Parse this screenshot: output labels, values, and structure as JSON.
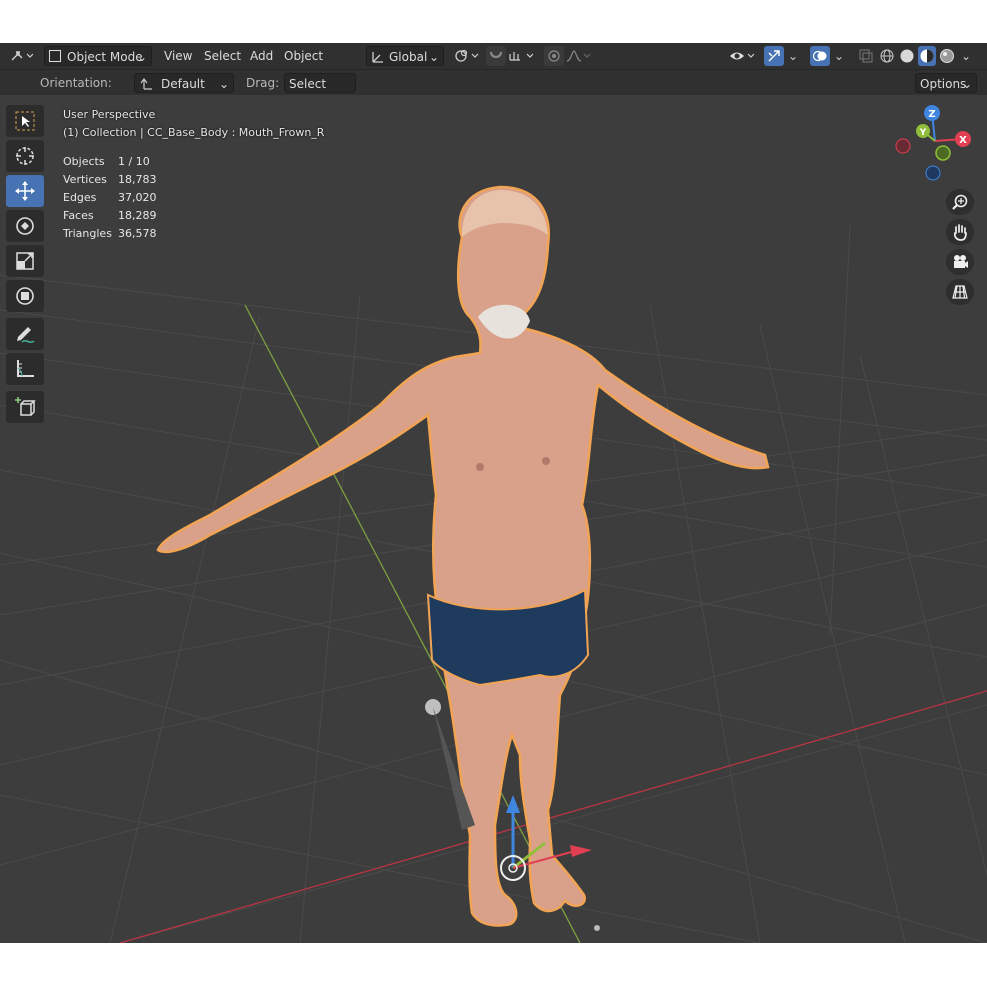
{
  "header": {
    "mode": "Object Mode",
    "menus": [
      "View",
      "Select",
      "Add",
      "Object"
    ],
    "transform_orientation": "Global"
  },
  "tool_settings": {
    "orientation_label": "Orientation:",
    "orientation_value": "Default",
    "drag_label": "Drag:",
    "drag_value": "Select Box",
    "options_label": "Options"
  },
  "viewport": {
    "view_name": "User Perspective",
    "collection_line": "(1) Collection | CC_Base_Body : Mouth_Frown_R",
    "stats": [
      {
        "label": "Objects",
        "value": "1 / 10"
      },
      {
        "label": "Vertices",
        "value": "18,783"
      },
      {
        "label": "Edges",
        "value": "37,020"
      },
      {
        "label": "Faces",
        "value": "18,289"
      },
      {
        "label": "Triangles",
        "value": "36,578"
      }
    ],
    "gizmo_axes": {
      "x": "X",
      "y": "Y",
      "z": "Z"
    },
    "colors": {
      "x_axis": "#e04052",
      "y_axis": "#8fbf3a",
      "z_axis": "#3f86e0",
      "active_tool": "#4772b3",
      "selection_outline": "#f0a050"
    }
  },
  "toolbar": {
    "tools": [
      "select-box-tool",
      "cursor-tool",
      "move-tool",
      "rotate-tool",
      "scale-tool",
      "transform-tool",
      "annotate-tool",
      "measure-tool",
      "add-cube-tool"
    ]
  }
}
